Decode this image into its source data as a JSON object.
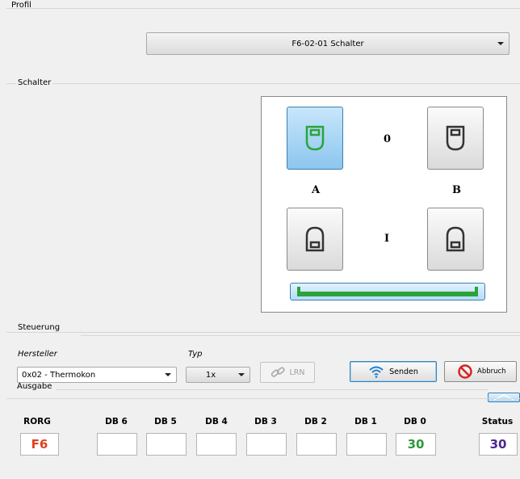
{
  "profil": {
    "title": "Profil",
    "selected": "F6-02-01 Schalter"
  },
  "schalter": {
    "title": "Schalter",
    "label_0": "0",
    "label_i": "I",
    "label_a": "A",
    "label_b": "B",
    "active_button": "A0",
    "colors": {
      "active_icon": "#2aa43a",
      "inactive_icon": "#333333",
      "indicator": "#2aa43a"
    }
  },
  "steuerung": {
    "title": "Steuerung",
    "hersteller_label": "Hersteller",
    "hersteller_value": "0x02 - Thermokon",
    "typ_label": "Typ",
    "typ_value": "1x",
    "lrn_label": "LRN",
    "senden_label": "Senden",
    "abbruch_label": "Abbruch"
  },
  "ausgabe": {
    "title": "Ausgabe",
    "columns": [
      {
        "name": "RORG",
        "value": "F6",
        "color": "#e0401f"
      },
      {
        "name": "DB 6",
        "value": "",
        "color": "#000000"
      },
      {
        "name": "DB 5",
        "value": "",
        "color": "#000000"
      },
      {
        "name": "DB 4",
        "value": "",
        "color": "#000000"
      },
      {
        "name": "DB 3",
        "value": "",
        "color": "#000000"
      },
      {
        "name": "DB 2",
        "value": "",
        "color": "#000000"
      },
      {
        "name": "DB 1",
        "value": "",
        "color": "#000000"
      },
      {
        "name": "DB 0",
        "value": "30",
        "color": "#2a9a3a"
      },
      {
        "name": "Status",
        "value": "30",
        "color": "#4b2a8c"
      }
    ]
  }
}
